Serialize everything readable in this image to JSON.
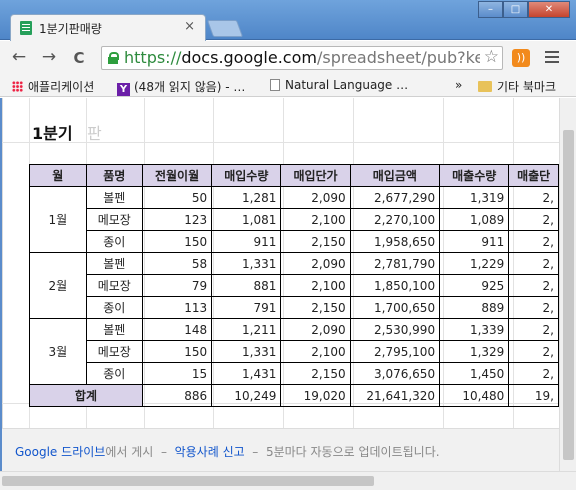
{
  "window": {
    "tab_title": "1분기판매량",
    "tab_close": "×",
    "min": "–",
    "max": "□",
    "close": "✕"
  },
  "toolbar": {
    "back": "←",
    "forward": "→",
    "reload": "C",
    "url_scheme": "https://",
    "url_host": "docs.google.com",
    "url_path": "/spreadsheet/pub?key=",
    "star": "☆"
  },
  "bookmarks": {
    "apps": "애플리케이션",
    "yahoo": "(48개 읽지 않음) - …",
    "natural_language": "Natural Language …",
    "overflow": "»",
    "other": "기타 북마크"
  },
  "sheet": {
    "title": "1분기",
    "title_tail": "판",
    "headers": [
      "월",
      "품명",
      "전월이월",
      "매입수량",
      "매입단가",
      "매입금액",
      "매출수량",
      "매출단"
    ],
    "months": [
      "1월",
      "2월",
      "3월"
    ],
    "rows": [
      {
        "item": "볼펜",
        "c1": "50",
        "c2": "1,281",
        "c3": "2,090",
        "c4": "2,677,290",
        "c5": "1,319",
        "c6": "2,"
      },
      {
        "item": "메모장",
        "c1": "123",
        "c2": "1,081",
        "c3": "2,100",
        "c4": "2,270,100",
        "c5": "1,089",
        "c6": "2,"
      },
      {
        "item": "종이",
        "c1": "150",
        "c2": "911",
        "c3": "2,150",
        "c4": "1,958,650",
        "c5": "911",
        "c6": "2,"
      },
      {
        "item": "볼펜",
        "c1": "58",
        "c2": "1,331",
        "c3": "2,090",
        "c4": "2,781,790",
        "c5": "1,229",
        "c6": "2,"
      },
      {
        "item": "메모장",
        "c1": "79",
        "c2": "881",
        "c3": "2,100",
        "c4": "1,850,100",
        "c5": "925",
        "c6": "2,"
      },
      {
        "item": "종이",
        "c1": "113",
        "c2": "791",
        "c3": "2,150",
        "c4": "1,700,650",
        "c5": "889",
        "c6": "2,"
      },
      {
        "item": "볼펜",
        "c1": "148",
        "c2": "1,211",
        "c3": "2,090",
        "c4": "2,530,990",
        "c5": "1,339",
        "c6": "2,"
      },
      {
        "item": "메모장",
        "c1": "150",
        "c2": "1,331",
        "c3": "2,100",
        "c4": "2,795,100",
        "c5": "1,329",
        "c6": "2,"
      },
      {
        "item": "종이",
        "c1": "15",
        "c2": "1,431",
        "c3": "2,150",
        "c4": "3,076,650",
        "c5": "1,450",
        "c6": "2,"
      }
    ],
    "total": {
      "label": "합계",
      "c1": "886",
      "c2": "10,249",
      "c3": "19,020",
      "c4": "21,641,320",
      "c5": "10,480",
      "c6": "19,"
    }
  },
  "footer": {
    "google": "Google",
    "drive": "드라이브",
    "published": "에서 게시",
    "dash1": "–",
    "report": "악용사례 신고",
    "dash2": "–",
    "auto_update": "5분마다 자동으로 업데이트됩니다."
  }
}
